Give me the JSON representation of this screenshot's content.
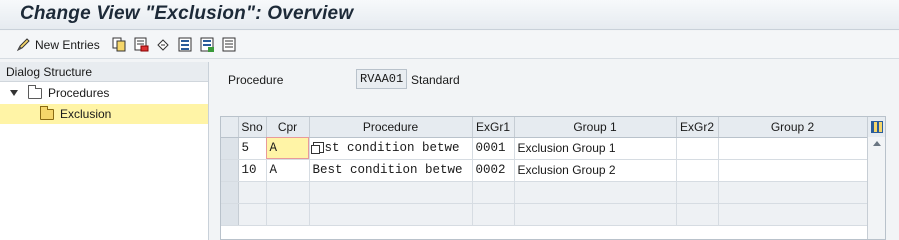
{
  "window": {
    "title": "Change View \"Exclusion\": Overview"
  },
  "toolbar": {
    "new_entries_label": "New Entries",
    "icons": [
      "new-entries-icon",
      "copy-as-icon",
      "delete-icon",
      "undo-change-icon",
      "select-all-icon",
      "select-block-icon",
      "deselect-all-icon"
    ]
  },
  "dialog_structure": {
    "header": "Dialog Structure",
    "items": [
      {
        "label": "Procedures",
        "level": 0,
        "expanded": true,
        "selected": false
      },
      {
        "label": "Exclusion",
        "level": 1,
        "expanded": false,
        "selected": true
      }
    ]
  },
  "header_fields": {
    "procedure_label": "Procedure",
    "procedure_value": "RVAA01",
    "procedure_desc": "Standard"
  },
  "table": {
    "columns": [
      "Sno",
      "Cpr",
      "Procedure",
      "ExGr1",
      "Group 1",
      "ExGr2",
      "Group 2"
    ],
    "rows": [
      {
        "sno": "5",
        "cpr": "A",
        "procedure": "st condition betwe",
        "exgr1": "0001",
        "group1": "Exclusion Group 1",
        "exgr2": "",
        "group2": ""
      },
      {
        "sno": "10",
        "cpr": "A",
        "procedure": "Best condition betwe",
        "exgr1": "0002",
        "group1": "Exclusion Group 2",
        "exgr2": "",
        "group2": ""
      }
    ]
  },
  "colors": {
    "highlight": "#fff4a6",
    "header_bg": "#e6ebf0"
  }
}
